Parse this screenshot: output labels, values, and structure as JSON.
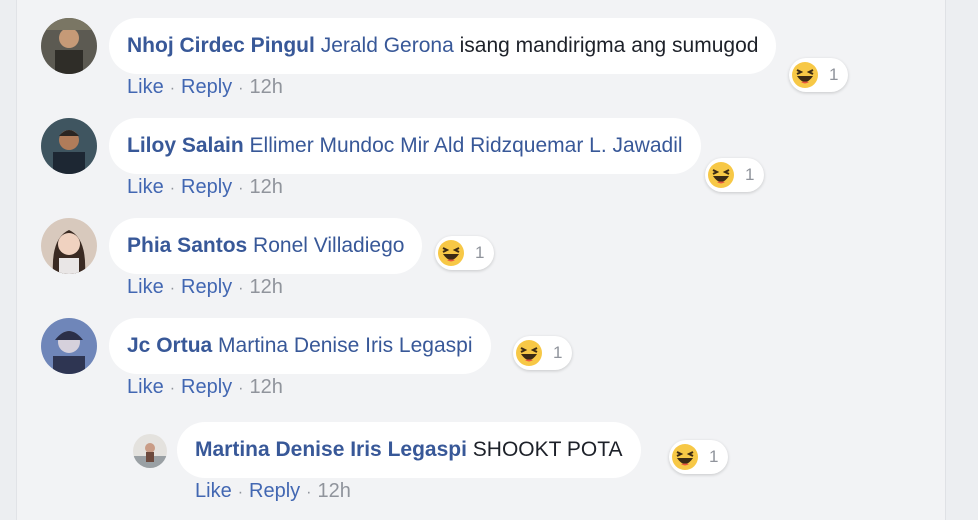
{
  "comments": [
    {
      "author": "Nhoj Cirdec Pingul",
      "tag": "Jerald Gerona",
      "text": "isang mandirigma ang sumugod",
      "like": "Like",
      "reply": "Reply",
      "sep": "·",
      "time": "12h",
      "reaction": {
        "icon": "haha-icon",
        "count": "1"
      }
    },
    {
      "author": "Liloy Salain",
      "tag": "Ellimer Mundoc Mir Ald Ridzquemar L. Jawadil",
      "text": "",
      "like": "Like",
      "reply": "Reply",
      "sep": "·",
      "time": "12h",
      "reaction": {
        "icon": "haha-icon",
        "count": "1"
      }
    },
    {
      "author": "Phia Santos",
      "tag": "Ronel Villadiego",
      "text": "",
      "like": "Like",
      "reply": "Reply",
      "sep": "·",
      "time": "12h",
      "reaction": {
        "icon": "haha-icon",
        "count": "1"
      }
    },
    {
      "author": "Jc Ortua",
      "tag": "Martina Denise Iris Legaspi",
      "text": "",
      "like": "Like",
      "reply": "Reply",
      "sep": "·",
      "time": "12h",
      "reaction": {
        "icon": "haha-icon",
        "count": "1"
      }
    },
    {
      "author": "Martina Denise Iris Legaspi",
      "tag": "",
      "text": "SHOOKT POTA",
      "like": "Like",
      "reply": "Reply",
      "sep": "·",
      "time": "12h",
      "reaction": {
        "icon": "haha-icon",
        "count": "1"
      }
    }
  ],
  "colors": {
    "name": "#385898",
    "link": "#4267b2",
    "meta": "#90949c",
    "haha": "#f7c846"
  }
}
